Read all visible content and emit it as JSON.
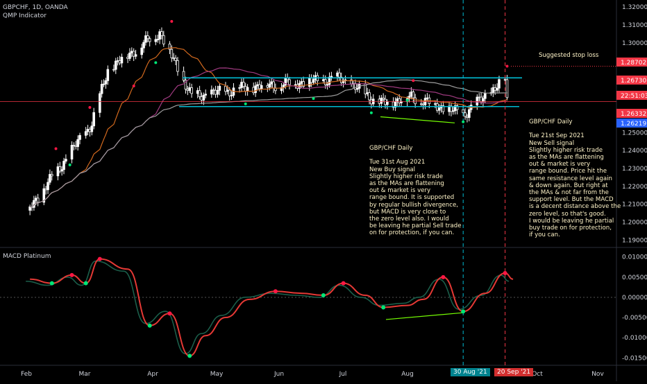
{
  "header": {
    "symbol": "GBPCHF, 1D, OANDA",
    "indicator": "QMP Indicator",
    "macd_label": "MACD Platinum"
  },
  "annotations": {
    "left": "GBP/CHF Daily\n\nTue 31st Aug 2021\nNew Buy signal\nSlightly higher risk trade\nas the MAs are flattening\nout & market is very\nrange bound. It is supported\nby regular bullish divergence,\nbut MACD is very close to\nthe zero level also. I would\nbe leaving he partial Sell trade\non for protection, if you can.",
    "right": "GBP/CHF Daily\n\nTue 21st Sep 2021\nNew Sell signal\nSlightly higher risk trade\nas the MAs are flattening\nout & market is very\nrange bound. Price hit the\nsame resistance level again\n& down again. But right at\nthe MAs & not far from the\nsupport level. But the MACD\nis a decent distance above the\nzero level, so that's good.\nI would be leaving he partial\nbuy trade on for protection,\nif you can.",
    "stop_loss": "Suggested stop loss"
  },
  "date_tags": [
    "30 Aug '21",
    "20 Sep '21"
  ],
  "price_tags": [
    {
      "text": "1.28702",
      "color": "#f23645"
    },
    {
      "text": "1.26730",
      "color": "#f23645"
    },
    {
      "text": "22:51:03",
      "color": "#f23645"
    },
    {
      "text": "1.26332",
      "color": "#f23645"
    },
    {
      "text": "1.26219",
      "color": "#2962ff"
    }
  ],
  "colors": {
    "background": "#000000",
    "candle": "#ffffff",
    "resistance": "#00bcd4",
    "ma_fast": "#d2691e",
    "ma_mid": "#a23b82",
    "ma_slow": "#9e9e9e",
    "macd": "#e53935",
    "signal": "#1b5e4a",
    "buy_dot": "#00e676",
    "sell_dot": "#ff1744",
    "divergence": "#76ff03"
  },
  "chart_data": [
    {
      "type": "candlestick",
      "title": "GBPCHF, 1D, OANDA",
      "x_ticks": [
        "Feb",
        "Mar",
        "Apr",
        "May",
        "Jun",
        "Jul",
        "Aug",
        "30 Aug '21",
        "20 Sep '21",
        "Oct",
        "Nov"
      ],
      "y_ticks": [
        1.32,
        1.31,
        1.3,
        1.29,
        1.28,
        1.27,
        1.26,
        1.25,
        1.24,
        1.23,
        1.22,
        1.21,
        1.2,
        1.19
      ],
      "y_tick_labels": [
        "1.32000",
        "1.31000",
        "1.30000",
        "1.29000",
        "1.28000",
        "1.27000",
        "1.26000",
        "1.25000",
        "1.24000",
        "1.23000",
        "1.22000",
        "1.21000",
        "1.20000",
        "1.19000"
      ],
      "ylim": [
        1.184,
        1.322
      ],
      "resistance_level": 1.2805,
      "support_level": 1.2645,
      "stop_loss_level": 1.28702,
      "close_line": 1.2673,
      "key_points": [
        {
          "date": "2021-01-25",
          "close": 1.208
        },
        {
          "date": "2021-02-25",
          "close": 1.255
        },
        {
          "date": "2021-03-05",
          "close": 1.285
        },
        {
          "date": "2021-03-31",
          "close": 1.306
        },
        {
          "date": "2021-04-16",
          "close": 1.27
        },
        {
          "date": "2021-05-20",
          "close": 1.276
        },
        {
          "date": "2021-06-30",
          "close": 1.28
        },
        {
          "date": "2021-07-20",
          "close": 1.266
        },
        {
          "date": "2021-08-04",
          "close": 1.27
        },
        {
          "date": "2021-08-30",
          "close": 1.26
        },
        {
          "date": "2021-09-20",
          "close": 1.2795
        },
        {
          "date": "2021-09-21",
          "close": 1.2673
        }
      ]
    },
    {
      "type": "line",
      "title": "MACD Platinum",
      "y_ticks": [
        0.01,
        0.005,
        0.0,
        -0.005,
        -0.01,
        -0.015
      ],
      "y_tick_labels": [
        "0.01000",
        "0.00500",
        "0.00000",
        "-0.00500",
        "-0.01000",
        "-0.01500"
      ],
      "ylim": [
        -0.0165,
        0.0115
      ],
      "series": [
        {
          "name": "MACD",
          "x": [
            "2021-01-25",
            "2021-02-05",
            "2021-02-15",
            "2021-02-22",
            "2021-03-01",
            "2021-03-15",
            "2021-03-26",
            "2021-04-05",
            "2021-04-15",
            "2021-04-23",
            "2021-05-03",
            "2021-05-15",
            "2021-05-28",
            "2021-06-10",
            "2021-06-21",
            "2021-07-01",
            "2021-07-12",
            "2021-07-21",
            "2021-08-02",
            "2021-08-10",
            "2021-08-20",
            "2021-08-30",
            "2021-09-10",
            "2021-09-20",
            "2021-09-24"
          ],
          "values": [
            0.0045,
            0.0035,
            0.0055,
            0.0035,
            0.0095,
            0.007,
            -0.007,
            -0.004,
            -0.0145,
            -0.0095,
            -0.005,
            -0.0005,
            0.0015,
            0.001,
            0.0005,
            0.0035,
            0.0005,
            -0.0025,
            -0.002,
            -0.0005,
            0.005,
            -0.0035,
            0.001,
            0.006,
            0.0045
          ]
        }
      ]
    }
  ]
}
